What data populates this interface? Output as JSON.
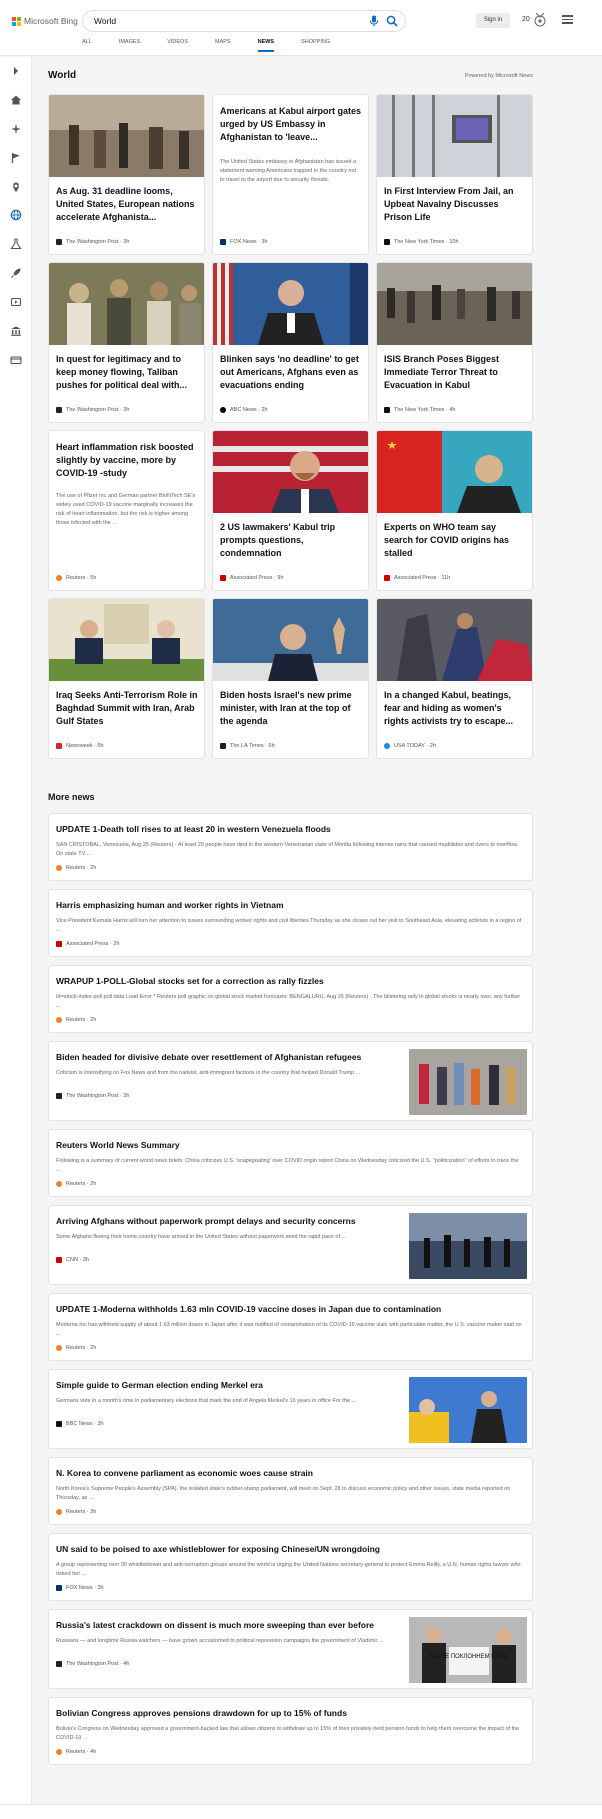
{
  "header": {
    "brand": "Microsoft Bing",
    "search_value": "World",
    "signin_label": "Sign in",
    "rewards_count": "20"
  },
  "tabs": [
    {
      "label": "ALL",
      "active": false
    },
    {
      "label": "IMAGES",
      "active": false
    },
    {
      "label": "VIDEOS",
      "active": false
    },
    {
      "label": "MAPS",
      "active": false
    },
    {
      "label": "NEWS",
      "active": true
    },
    {
      "label": "SHOPPING",
      "active": false
    }
  ],
  "rail_icons": [
    "expand-icon",
    "home-icon",
    "discover-icon",
    "flag-icon",
    "location-icon",
    "globe-icon",
    "science-icon",
    "rocket-icon",
    "entertainment-icon",
    "government-icon",
    "money-icon"
  ],
  "section": {
    "title": "World",
    "powered_by": "Powered by Microsoft News"
  },
  "cards": [
    {
      "title": "As Aug. 31 deadline looms, United States, European nations accelerate Afghanista...",
      "source": "The Washington Post",
      "time": "3h",
      "image": "crowd-airport-photo",
      "src_color": "#222"
    },
    {
      "title": "Americans at Kabul airport gates urged by US Embassy in Afghanistan to 'leave...",
      "desc": "The United States embassy in Afghanistan has issued a statement warning Americans trapped in the country not to travel to the airport due to security threats.",
      "source": "FOX News",
      "time": "3h",
      "src_color": "#003366"
    },
    {
      "title": "In First Interview From Jail, an Upbeat Navalny Discusses Prison Life",
      "source": "The New York Times",
      "time": "10h",
      "image": "prison-screen-photo",
      "src_color": "#111"
    },
    {
      "title": "In quest for legitimacy and to keep money flowing, Taliban pushes for political deal with...",
      "source": "The Washington Post",
      "time": "3h",
      "image": "taliban-group-photo",
      "src_color": "#222"
    },
    {
      "title": "Blinken says 'no deadline' to get out Americans, Afghans even as evacuations ending",
      "source": "ABC News",
      "time": "2h",
      "image": "blinken-photo",
      "src_color": "#000"
    },
    {
      "title": "ISIS Branch Poses Biggest Immediate Terror Threat to Evacuation in Kabul",
      "source": "The New York Times",
      "time": "4h",
      "image": "kabul-crowd-photo",
      "src_color": "#111"
    },
    {
      "title": "Heart inflammation risk boosted slightly by vaccine, more by COVID-19 -study",
      "desc": "The use of Pfizer Inc and German partner BioNTech SE's widely used COVID-19 vaccine marginally increases the risk of heart inflammation, but the risk is higher among those infected with the ...",
      "source": "Reuters",
      "time": "5h",
      "src_color": "#f08030"
    },
    {
      "title": "2 US lawmakers' Kabul trip prompts questions, condemnation",
      "source": "Associated Press",
      "time": "9h",
      "image": "lawmaker-photo",
      "src_color": "#c00"
    },
    {
      "title": "Experts on WHO team say search for COVID origins has stalled",
      "source": "Associated Press",
      "time": "11h",
      "image": "china-official-photo",
      "src_color": "#c00"
    },
    {
      "title": "Iraq Seeks Anti-Terrorism Role in Baghdad Summit with Iran, Arab Gulf States",
      "source": "Newsweek",
      "time": "5h",
      "image": "oval-office-photo",
      "src_color": "#d22"
    },
    {
      "title": "Biden hosts Israel's new prime minister, with Iran at the top of the agenda",
      "source": "The LA Times",
      "time": "5h",
      "image": "bennett-photo",
      "src_color": "#222"
    },
    {
      "title": "In a changed Kabul, beatings, fear and hiding as women's rights activists try to escape...",
      "source": "USA TODAY",
      "time": "2h",
      "image": "kabul-women-photo",
      "src_color": "#1e88e5"
    }
  ],
  "more_news": {
    "title": "More news",
    "items": [
      {
        "title": "UPDATE 1-Death toll rises to at least 20 in western Venezuela floods",
        "desc": "SAN CRISTOBAL, Venezuela, Aug 25 (Reuters) - At least 20 people have died in the western Venezuelan state of Merida following intense rains that caused mudslides and rivers to overflow. On state TV ...",
        "source": "Reuters",
        "time": "2h",
        "src_color": "#f08030"
      },
      {
        "title": "Harris emphasizing human and worker rights in Vietnam",
        "desc": "Vice President Kamala Harris will turn her attention to issues surrounding worker rights and civil liberties Thursday as she closes out her visit to Southeast Asia, elevating activists in a region of ...",
        "source": "Associated Press",
        "time": "2h",
        "src_color": "#c00"
      },
      {
        "title": "WRAPUP 1-POLL-Global stocks set for a correction as rally fizzles",
        "desc": "Id=stock-index-poll poll data Load Error * Reuters poll graphic on global stock market forecasts: BENGALURU, Aug 26 (Reuters) - The blistering rally in global stocks is nearly over, any further ...",
        "source": "Reuters",
        "time": "2h",
        "src_color": "#f08030"
      },
      {
        "title": "Biden headed for divisive debate over resettlement of Afghanistan refugees",
        "desc": "Criticism is intensifying on Fox News and from the nativist, anti-immigrant factions in the country that helped Donald Trump ...",
        "source": "The Washington Post",
        "time": "3h",
        "image": "refugees-photo",
        "src_color": "#222"
      },
      {
        "title": "Reuters World News Summary",
        "desc": "Following is a summary of current world news briefs. China criticizes U.S. 'scapegoating' over COVID origin report China on Wednesday criticized the U.S. \"politicization\" of efforts to trace the ...",
        "source": "Reuters",
        "time": "2h",
        "src_color": "#f08030"
      },
      {
        "title": "Arriving Afghans without paperwork prompt delays and security concerns",
        "desc": "Some Afghans fleeing their home country have arrived in the United States without paperwork amid the rapid pace of ...",
        "source": "CNN",
        "time": "3h",
        "image": "silhouettes-photo",
        "src_color": "#c00"
      },
      {
        "title": "UPDATE 1-Moderna withholds 1.63 mln COVID-19 vaccine doses in Japan due to contamination",
        "desc": "Moderna Inc has withheld supply of about 1.63 million doses in Japan after it was notified of contamination of its COVID-19 vaccine vials with particulate matter, the U.S. vaccine maker said on ...",
        "source": "Reuters",
        "time": "2h",
        "src_color": "#f08030"
      },
      {
        "title": "Simple guide to German election ending Merkel era",
        "desc": "Germans vote in a month's time in parliamentary elections that mark the end of Angela Merkel's 16 years in office For the ...",
        "source": "BBC News",
        "time": "3h",
        "image": "election-photo",
        "src_color": "#111"
      },
      {
        "title": "N. Korea to convene parliament as economic woes cause strain",
        "desc": "North Korea's Supreme People's Assembly (SPA), the isolated state's rubber-stamp parliament, will meet on Sept. 28 to discuss economic policy and other issues, state media reported on Thursday, as ...",
        "source": "Reuters",
        "time": "3h",
        "src_color": "#f08030"
      },
      {
        "title": "UN said to be poised to axe whistleblower for exposing Chinese/UN wrongdoing",
        "desc": "A group representing over 30 whistleblower and anti-corruption groups around the world is urging the United Nations secretary-general to protect Emma Reilly, a U.N. human rights lawyer who risked her ...",
        "source": "FOX News",
        "time": "3h",
        "src_color": "#003366"
      },
      {
        "title": "Russia's latest crackdown on dissent is much more sweeping than ever before",
        "desc": "Russians — and longtime Russia watchers — have grown accustomed to political repression campaigns the government of Vladimir ...",
        "source": "The Washington Post",
        "time": "4h",
        "image": "protest-photo",
        "sign": "Мы НЕ ПОКЛОННЕМ БЫТЬ",
        "src_color": "#222"
      },
      {
        "title": "Bolivian Congress approves pensions drawdown for up to 15% of funds",
        "desc": "Bolivia's Congress on Wednesday approved a government-backed law that allows citizens to withdraw up to 15% of their privately-held pension funds to help them overcome the impact of the COVID-19 ...",
        "source": "Reuters",
        "time": "4h",
        "src_color": "#f08030"
      }
    ]
  },
  "footer": {}
}
